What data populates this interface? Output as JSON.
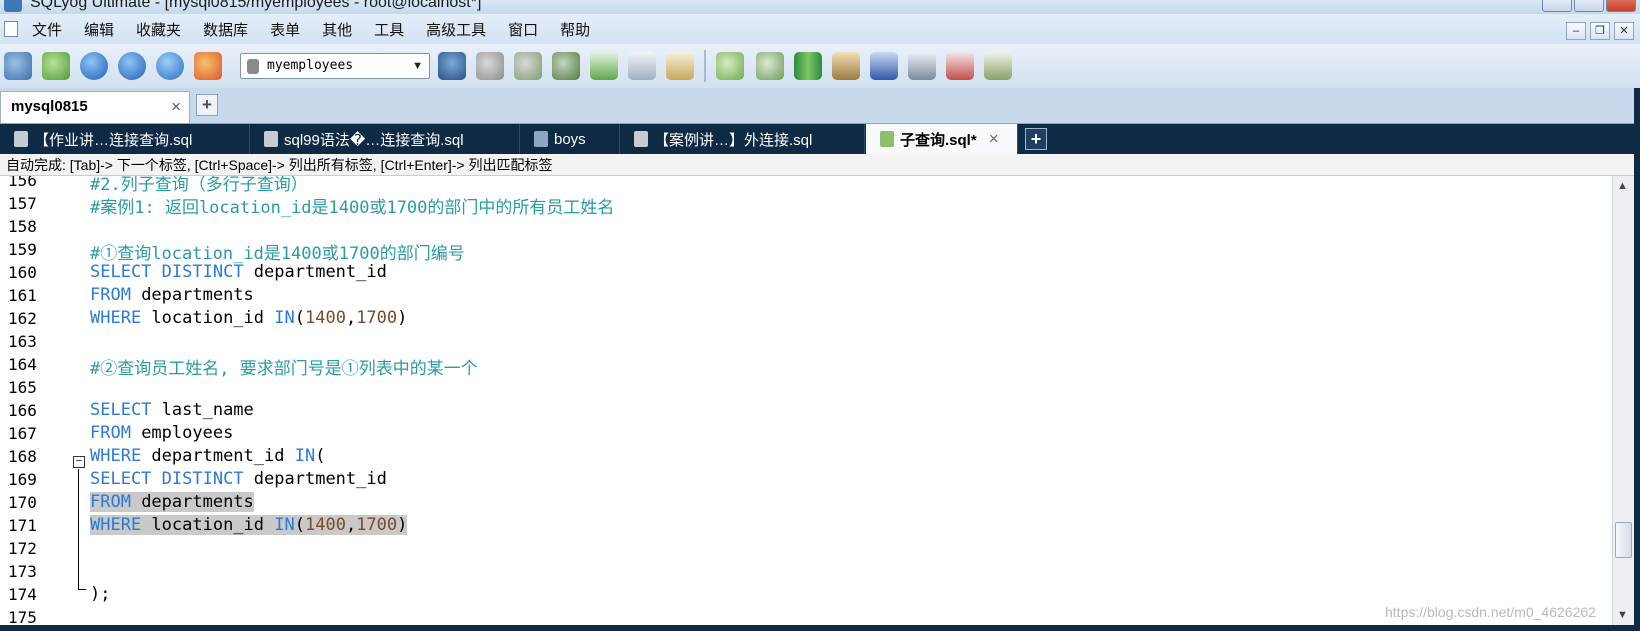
{
  "window": {
    "title": "SQLyog Ultimate - [mysql0815/myemployees - root@localhost*]"
  },
  "menu": {
    "items": [
      "文件",
      "编辑",
      "收藏夹",
      "数据库",
      "表单",
      "其他",
      "工具",
      "高级工具",
      "窗口",
      "帮助"
    ]
  },
  "toolbar": {
    "database": "myemployees"
  },
  "connection_tab": {
    "label": "mysql0815",
    "close": "×",
    "add": "+"
  },
  "query_tabs": {
    "tabs": [
      {
        "label": "【作业讲…连接查询.sql"
      },
      {
        "label": "sql99语法�…连接查询.sql"
      },
      {
        "label": "boys"
      },
      {
        "label": "【案例讲…】外连接.sql"
      },
      {
        "label": "子查询.sql*",
        "active": true
      }
    ],
    "close": "×",
    "add": "+"
  },
  "hint": {
    "text": "自动完成: [Tab]-> 下一个标签, [Ctrl+Space]-> 列出所有标签, [Ctrl+Enter]-> 列出匹配标签"
  },
  "editor": {
    "lines": [
      {
        "no": "156",
        "text": "#2.列子查询（多行子查询）"
      },
      {
        "no": "157",
        "text": "#案例1: 返回location_id是1400或1700的部门中的所有员工姓名"
      },
      {
        "no": "158",
        "text": ""
      },
      {
        "no": "159",
        "text": "#①查询location_id是1400或1700的部门编号"
      },
      {
        "no": "160",
        "text": "SELECT DISTINCT department_id"
      },
      {
        "no": "161",
        "text": "FROM departments"
      },
      {
        "no": "162",
        "text": "WHERE location_id IN(1400,1700)"
      },
      {
        "no": "163",
        "text": ""
      },
      {
        "no": "164",
        "text": "#②查询员工姓名, 要求部门号是①列表中的某一个"
      },
      {
        "no": "165",
        "text": ""
      },
      {
        "no": "166",
        "text": "SELECT last_name"
      },
      {
        "no": "167",
        "text": "FROM employees"
      },
      {
        "no": "168",
        "text": "WHERE department_id IN("
      },
      {
        "no": "169",
        "text": "SELECT DISTINCT department_id"
      },
      {
        "no": "170",
        "text": "FROM departments"
      },
      {
        "no": "171",
        "text": "WHERE location_id IN(1400,1700)"
      },
      {
        "no": "172",
        "text": ""
      },
      {
        "no": "173",
        "text": ""
      },
      {
        "no": "174",
        "text": ");"
      },
      {
        "no": "175",
        "text": ""
      }
    ]
  },
  "watermark": "https://blog.csdn.net/m0_4626262",
  "colors": {
    "keyword": "#2b7ad6",
    "comment": "#2a9ba5",
    "selection": "#c9c9c9",
    "tab_strip": "#0e2a44"
  }
}
